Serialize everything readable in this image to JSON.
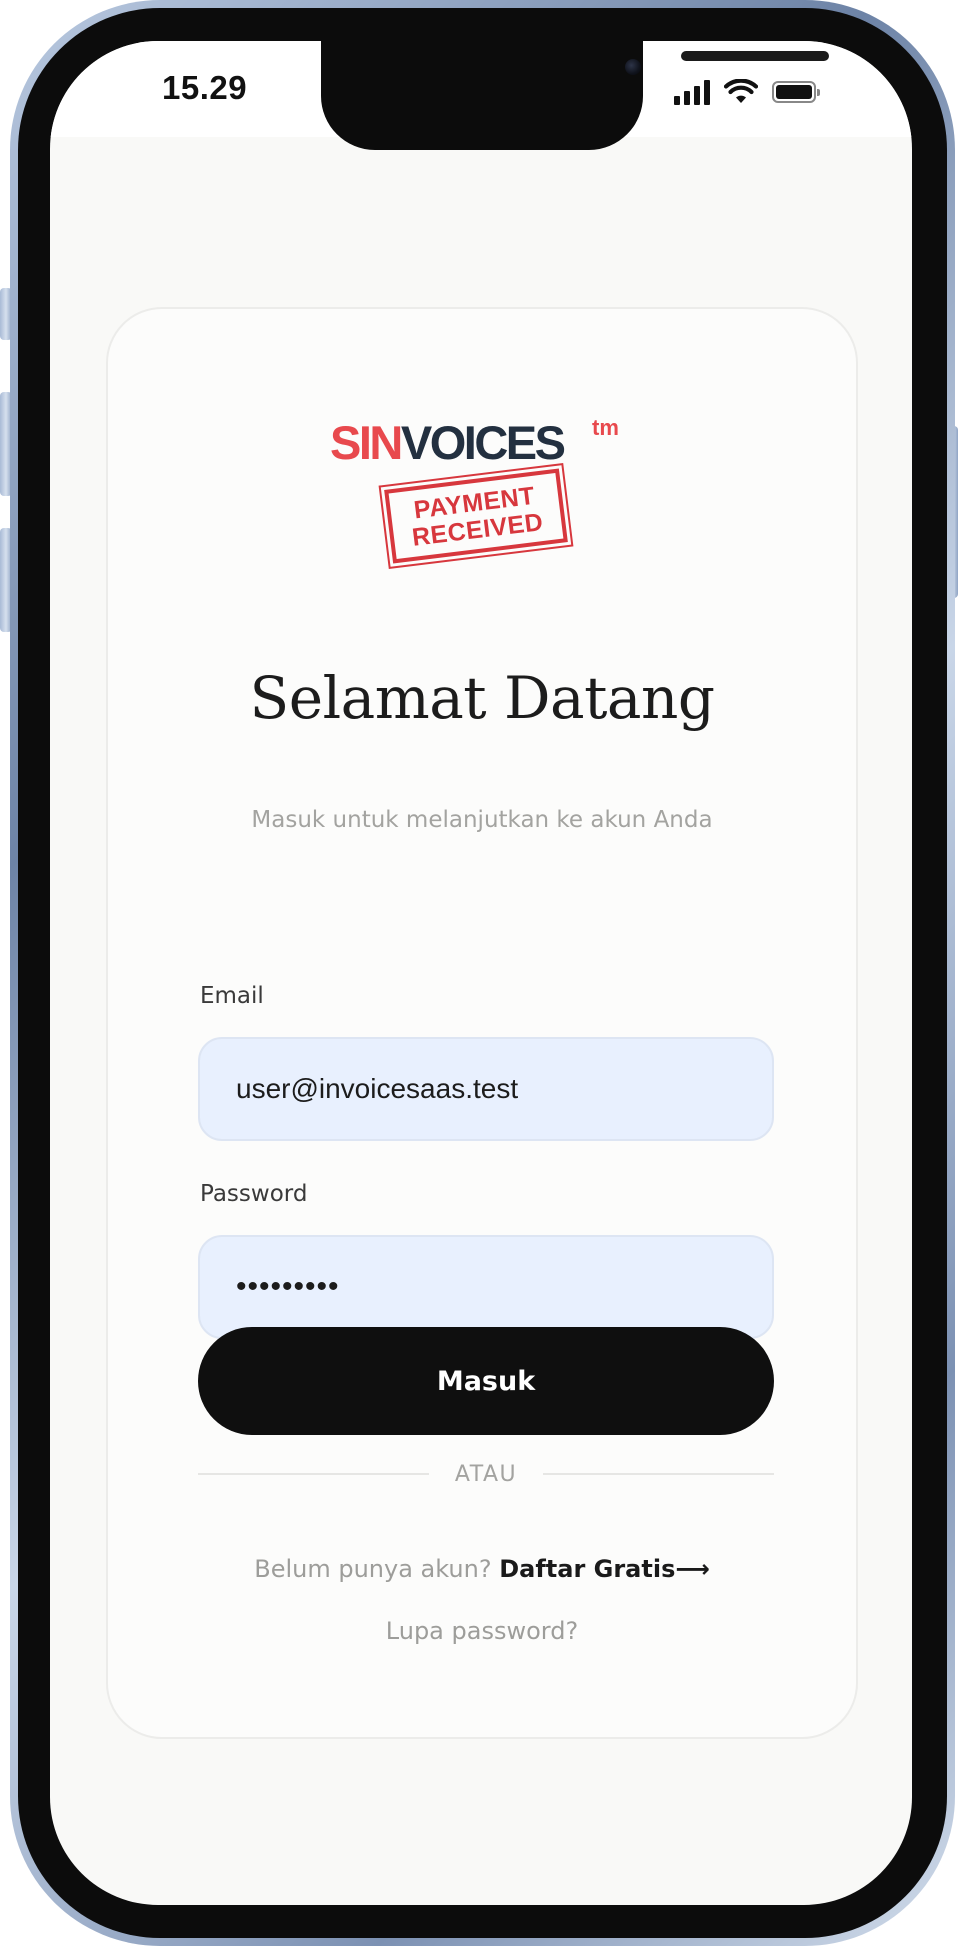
{
  "status_bar": {
    "time": "15.29",
    "icons": [
      "cellular-signal-icon",
      "wifi-icon",
      "battery-icon"
    ]
  },
  "brand": {
    "logo_part1": "SIN",
    "logo_part2": "VOICES",
    "logo_tm": "tm",
    "stamp_line1": "PAYMENT",
    "stamp_line2": "RECEIVED"
  },
  "login": {
    "title": "Selamat Datang",
    "subtitle": "Masuk untuk melanjutkan ke akun Anda",
    "email_label": "Email",
    "email_value": "user@invoicesaas.test",
    "password_label": "Password",
    "password_value": "•••••••••",
    "submit_label": "Masuk",
    "divider_text": "ATAU",
    "signup_prompt": "Belum punya akun?",
    "signup_link": "Daftar Gratis",
    "signup_arrow": "⟶",
    "forgot_link": "Lupa password?"
  },
  "colors": {
    "brand_red": "#e8494d",
    "brand_dark": "#233040",
    "stamp_red": "#d7373d",
    "input_bg": "#e8f0fe",
    "button_bg": "#0f0f0f",
    "button_text": "#ffffff",
    "muted_text": "#a3a3a0",
    "frame_accent": "#8fa4c4"
  }
}
